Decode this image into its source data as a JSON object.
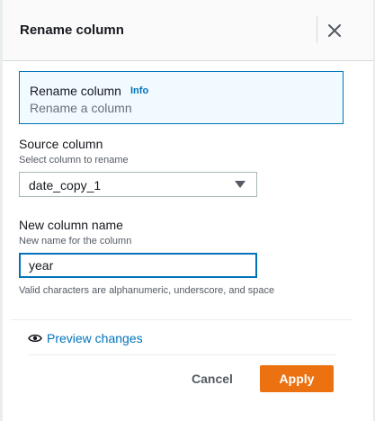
{
  "header": {
    "title": "Rename column",
    "close_icon": "close-icon"
  },
  "info_box": {
    "title": "Rename column",
    "info_link": "Info",
    "subtitle": "Rename a column"
  },
  "source_column": {
    "label": "Source column",
    "description": "Select column to rename",
    "selected_value": "date_copy_1"
  },
  "new_column": {
    "label": "New column name",
    "description": "New name for the column",
    "value": "year",
    "hint": "Valid characters are alphanumeric, underscore, and space"
  },
  "preview": {
    "icon": "eye-icon",
    "label": "Preview changes"
  },
  "footer": {
    "cancel_label": "Cancel",
    "apply_label": "Apply"
  },
  "colors": {
    "accent": "#0073bb",
    "apply_button": "#ec7211",
    "info_background": "#f1faff"
  }
}
